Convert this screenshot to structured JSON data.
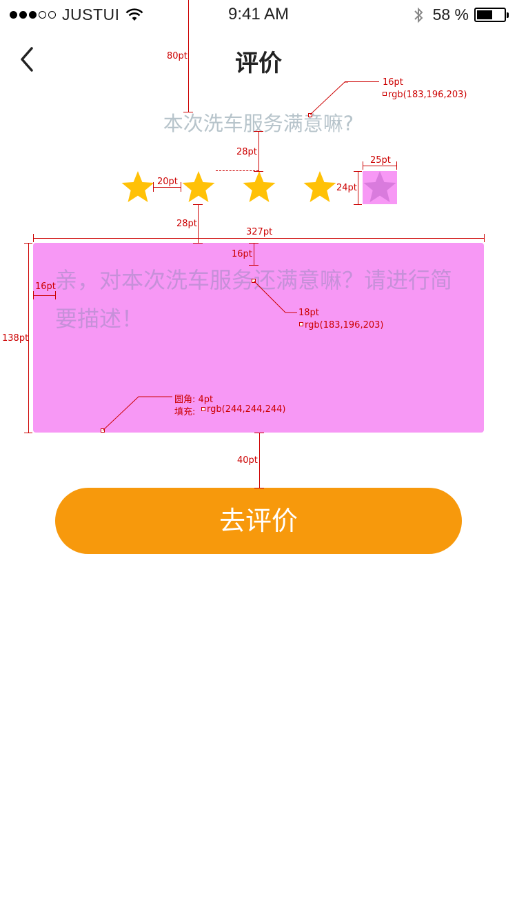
{
  "status_bar": {
    "carrier": "JUSTUI",
    "time": "9:41 AM",
    "battery_percent": "58 %",
    "battery_level": 0.58,
    "signal_bars_filled": 3,
    "signal_bars_total": 5
  },
  "nav": {
    "back_icon": "chevron-left-icon",
    "title": "评价"
  },
  "rating": {
    "question": "本次洗车服务满意嘛?",
    "max_stars": 5,
    "selected_stars": 4,
    "star_color": "#FFC107",
    "unselected_star_color": "#D97BDD"
  },
  "review": {
    "placeholder": "亲，对本次洗车服务还满意嘛？请进行简要描述！",
    "fill_color": "rgb(244,244,244)"
  },
  "submit": {
    "label": "去评价",
    "color": "#F7990C"
  },
  "annotations": {
    "nav_height": "80pt",
    "question_font": "16pt",
    "question_color": "rgb(183,196,203)",
    "question_to_stars": "28pt",
    "star_gap": "20pt",
    "star_width": "25pt",
    "star_height": "24pt",
    "stars_to_box": "28pt",
    "box_width": "327pt",
    "box_padding_top": "16pt",
    "box_padding_left": "16pt",
    "box_height": "138pt",
    "placeholder_font": "18pt",
    "placeholder_color": "rgb(183,196,203)",
    "corner_label": "圆角:",
    "corner_value": "4pt",
    "fill_label": "填充:",
    "fill_value": "rgb(244,244,244)",
    "box_to_button": "40pt"
  }
}
